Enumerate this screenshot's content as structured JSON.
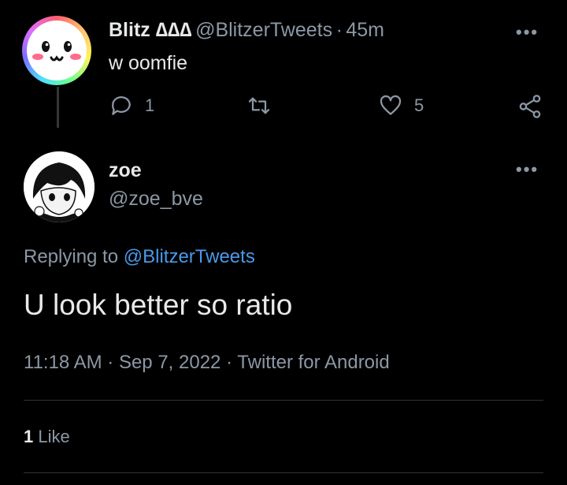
{
  "parent_tweet": {
    "display_name": "Blitz ∆∆∆",
    "handle": "@BlitzerTweets",
    "separator": "·",
    "time_ago": "45m",
    "text": "w oomfie",
    "reply_count": "1",
    "like_count": "5",
    "icons": [
      "reply-icon",
      "retweet-icon",
      "like-icon",
      "share-icon",
      "more-options-icon"
    ]
  },
  "reply_tweet": {
    "display_name": "zoe",
    "handle": "@zoe_bve",
    "replying_to_label": "Replying to",
    "replying_to_handle": "@BlitzerTweets",
    "text": "U look better so ratio",
    "timestamp": "11:18 AM · Sep 7, 2022 · Twitter for Android",
    "like_stat_count": "1",
    "like_stat_label": "Like"
  },
  "colors": {
    "background": "#000000",
    "text": "#e7e9ea",
    "muted": "#8b98a5",
    "link": "#4a99e9",
    "divider": "#2f3336"
  }
}
